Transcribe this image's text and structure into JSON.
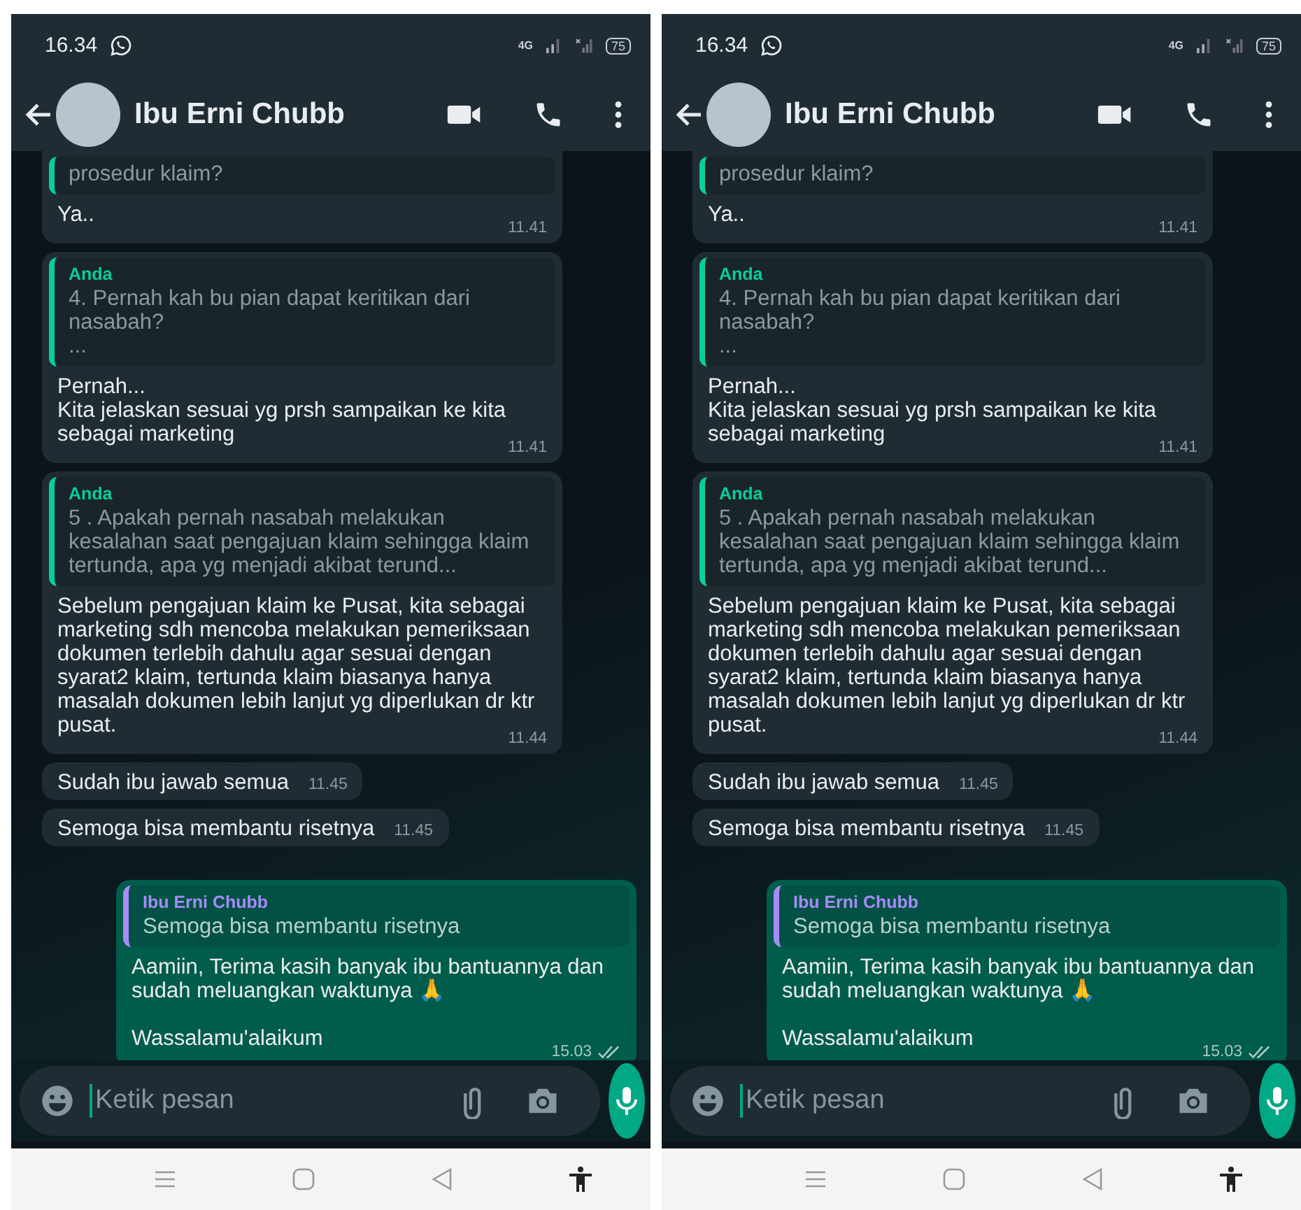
{
  "screens": [
    {
      "status": {
        "time": "16.34",
        "network": "4G",
        "battery": "75"
      },
      "header": {
        "title": "Ibu Erni Chubb"
      },
      "messages": [
        {
          "kind": "incoming",
          "cut_top": true,
          "quote": {
            "text": "prosedur klaim?"
          },
          "paragraphs": [
            {
              "text": "Ya.."
            }
          ],
          "time": "11.41"
        },
        {
          "kind": "incoming",
          "cut_top": false,
          "quote": {
            "author": "Anda",
            "text": "4. Pernah kah bu pian dapat keritikan dari nasabah?\n..."
          },
          "paragraphs": [
            {
              "text": "Pernah...\nKita jelaskan sesuai yg prsh sampaikan ke kita sebagai marketing"
            }
          ],
          "time": "11.41"
        },
        {
          "kind": "incoming",
          "cut_top": false,
          "quote": {
            "author": "Anda",
            "text": "5 . Apakah pernah nasabah melakukan kesalahan saat pengajuan klaim sehingga klaim tertunda, apa yg menjadi akibat terund..."
          },
          "paragraphs": [
            {
              "text": "Sebelum pengajuan klaim ke Pusat, kita sebagai marketing sdh mencoba melakukan pemeriksaan dokumen terlebih dahulu agar sesuai dengan syarat2 klaim, tertunda klaim biasanya hanya masalah dokumen lebih lanjut yg diperlukan dr ktr pusat."
            }
          ],
          "time": "11.44"
        },
        {
          "kind": "incoming",
          "cut_top": false,
          "paragraphs": [
            {
              "text": "Sudah ibu jawab semua"
            }
          ],
          "time": "11.45"
        },
        {
          "kind": "incoming",
          "cut_top": false,
          "paragraphs": [
            {
              "text": "Semoga bisa membantu risetnya"
            }
          ],
          "time": "11.45"
        },
        {
          "kind": "outgoing",
          "cut_top": false,
          "quote": {
            "author": "Ibu Erni Chubb",
            "text": "Semoga bisa membantu risetnya"
          },
          "paragraphs": [
            {
              "text": "Aamiin, Terima kasih banyak ibu bantuannya dan sudah meluangkan waktunya 🙏"
            },
            {
              "text": "Wassalamu'alaikum"
            }
          ],
          "time": "15.03",
          "read": false
        }
      ],
      "composer": {
        "placeholder": "Ketik pesan"
      }
    },
    {
      "status": {
        "time": "16.34",
        "network": "4G",
        "battery": "75"
      },
      "header": {
        "title": "Ibu Erni Chubb"
      },
      "messages": [
        {
          "kind": "incoming",
          "cut_top": true,
          "quote": {
            "text": "prosedur klaim?"
          },
          "paragraphs": [
            {
              "text": "Ya.."
            }
          ],
          "time": "11.41"
        },
        {
          "kind": "incoming",
          "cut_top": false,
          "quote": {
            "author": "Anda",
            "text": "4. Pernah kah bu pian dapat keritikan dari nasabah?\n..."
          },
          "paragraphs": [
            {
              "text": "Pernah...\nKita jelaskan sesuai yg prsh sampaikan ke kita sebagai marketing"
            }
          ],
          "time": "11.41"
        },
        {
          "kind": "incoming",
          "cut_top": false,
          "quote": {
            "author": "Anda",
            "text": "5 . Apakah pernah nasabah melakukan kesalahan saat pengajuan klaim sehingga klaim tertunda, apa yg menjadi akibat terund..."
          },
          "paragraphs": [
            {
              "text": "Sebelum pengajuan klaim ke Pusat, kita sebagai marketing sdh mencoba melakukan pemeriksaan dokumen terlebih dahulu agar sesuai dengan syarat2 klaim, tertunda klaim biasanya hanya masalah dokumen lebih lanjut yg diperlukan dr ktr pusat."
            }
          ],
          "time": "11.44"
        },
        {
          "kind": "incoming",
          "cut_top": false,
          "paragraphs": [
            {
              "text": "Sudah ibu jawab semua"
            }
          ],
          "time": "11.45"
        },
        {
          "kind": "incoming",
          "cut_top": false,
          "paragraphs": [
            {
              "text": "Semoga bisa membantu risetnya"
            }
          ],
          "time": "11.45"
        },
        {
          "kind": "outgoing",
          "cut_top": false,
          "quote": {
            "author": "Ibu Erni Chubb",
            "text": "Semoga bisa membantu risetnya"
          },
          "paragraphs": [
            {
              "text": "Aamiin, Terima kasih banyak ibu bantuannya dan sudah meluangkan waktunya 🙏"
            },
            {
              "text": "Wassalamu'alaikum"
            }
          ],
          "time": "15.03",
          "read": false
        }
      ],
      "composer": {
        "placeholder": "Ketik pesan"
      }
    }
  ]
}
